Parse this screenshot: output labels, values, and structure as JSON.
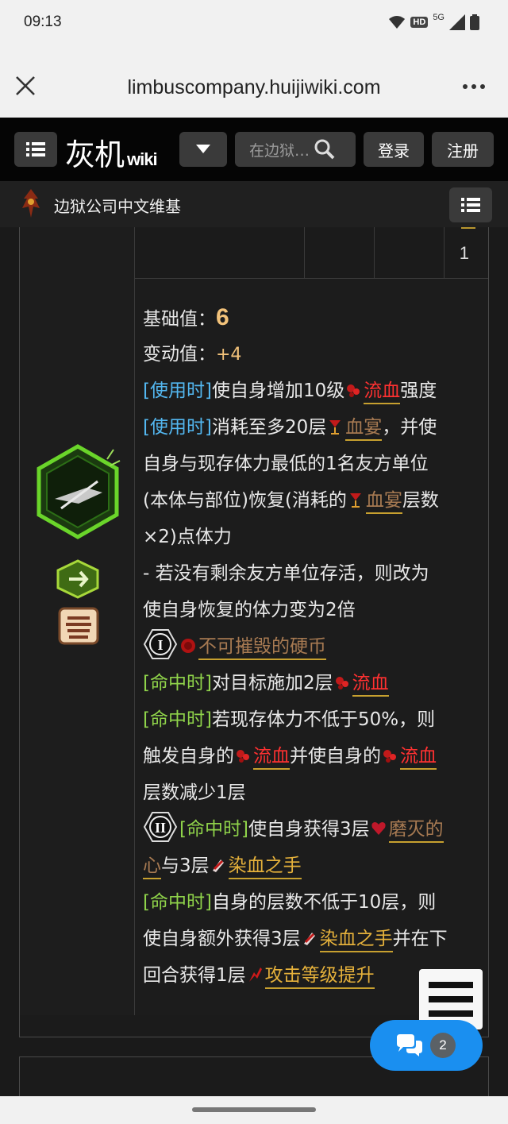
{
  "status": {
    "time": "09:13",
    "network": "5G",
    "hd": "HD"
  },
  "browser": {
    "url": "limbuscompany.huijiwiki.com"
  },
  "site": {
    "logo_main": "灰机",
    "logo_sub": "wiki",
    "search_placeholder": "在边狱…",
    "login_label": "登录",
    "register_label": "注册",
    "site_name": "边狱公司中文维基"
  },
  "table_top": {
    "row_value": "1"
  },
  "skill": {
    "base_label": "基础值：",
    "base_value": "6",
    "change_label": "变动值：",
    "change_value": "+4",
    "tags": {
      "use": "[使用时]",
      "hit": "[命中时]"
    },
    "keywords": {
      "bleed": "流血",
      "blood_feast": "血宴",
      "unbreakable": "不可摧毁的硬币",
      "worn_heart_a": "磨灭的",
      "worn_heart_b": "心",
      "bloody_hand": "染血之手",
      "atk_up": "攻击等级提升"
    },
    "text": {
      "t1": "使自身增加10级",
      "t1b": "强度",
      "t2": "消耗至多20层",
      "t2b": "，并使",
      "t3": "自身与现存体力最低的1名友方单位",
      "t4": "(本体与部位)恢复(消耗的",
      "t4b": "层数",
      "t5": "×2)点体力",
      "t6": "- 若没有剩余友方单位存活，则改为",
      "t7": "使自身恢复的体力变为2倍",
      "t8": "对目标施加2层",
      "t9": "若现存体力不低于50%，则",
      "t10": "触发自身的",
      "t10b": "并使自身的",
      "t11": "层数减少1层",
      "t12": "使自身获得3层",
      "t13": "与3层",
      "t14": "自身的层数不低于10层，则",
      "t15": "使自身额外获得3层",
      "t15b": "并在下",
      "t16": "回合获得1层"
    },
    "coins": {
      "c1": "I",
      "c2": "II"
    }
  },
  "chat": {
    "count": "2"
  },
  "colors": {
    "use_tag": "#53b7f0",
    "hit_tag": "#8fd34a",
    "bleed": "#ff3131",
    "accent_gold": "#e5b13b",
    "chat_button": "#1a8ff0"
  },
  "icons": [
    "close-icon",
    "more-icon",
    "wifi-icon",
    "signal-icon",
    "battery-icon",
    "list-icon",
    "dropdown-icon",
    "search-icon",
    "menu-icon",
    "chat-icon",
    "bleed-icon",
    "blood-feast-icon",
    "unbreakable-coin-icon",
    "worn-heart-icon",
    "bloody-hand-icon",
    "atk-up-icon",
    "skill-icon",
    "attack-type-icon",
    "sin-affinity-icon"
  ]
}
